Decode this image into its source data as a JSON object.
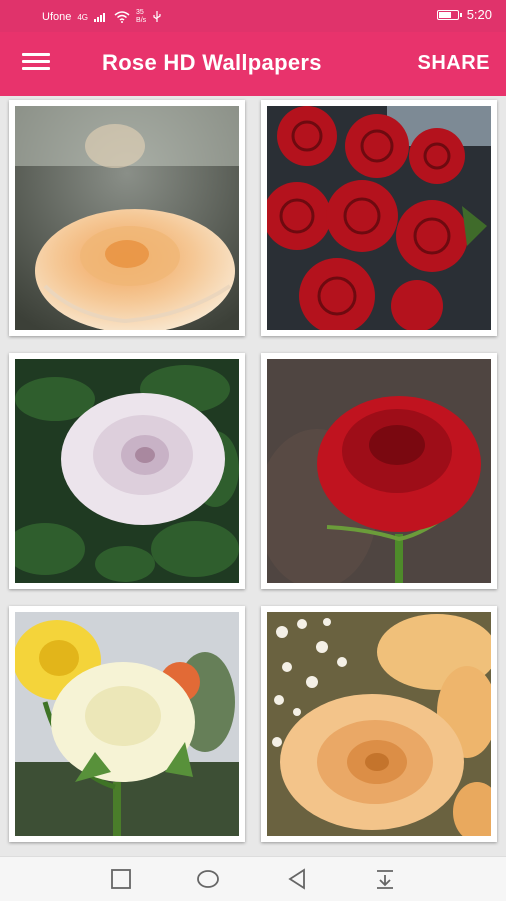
{
  "status_bar": {
    "carrier": "Ufone",
    "network": "4G",
    "speed_value": "35",
    "speed_unit": "B/s",
    "time": "5:20",
    "battery_level": 0.75
  },
  "app_bar": {
    "title": "Rose HD Wallpapers",
    "share_label": "SHARE",
    "menu_icon": "hamburger-menu-icon"
  },
  "wallpapers": [
    {
      "subject": "peach rose"
    },
    {
      "subject": "red roses bouquet"
    },
    {
      "subject": "white lavender rose"
    },
    {
      "subject": "single red rose"
    },
    {
      "subject": "cream and yellow roses"
    },
    {
      "subject": "peach roses with baby's breath"
    }
  ],
  "nav_bar": {
    "buttons": [
      "square-recents-icon",
      "circle-home-icon",
      "triangle-back-icon",
      "notification-down-icon"
    ]
  },
  "colors": {
    "accent": "#e8336c",
    "status_bar": "#e0336b",
    "background": "#e8e8e8"
  }
}
